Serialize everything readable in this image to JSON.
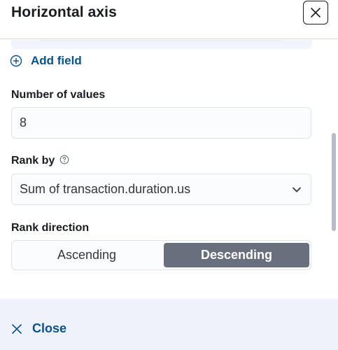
{
  "header": {
    "title": "Horizontal axis",
    "close_icon": "close-icon"
  },
  "add_field": {
    "label": "Add field",
    "icon": "plus-circle-icon"
  },
  "number_of_values": {
    "label": "Number of values",
    "value": "8"
  },
  "rank_by": {
    "label": "Rank by",
    "help_icon": "question-circle-icon",
    "selected": "Sum of transaction.duration.us"
  },
  "rank_direction": {
    "label": "Rank direction",
    "options": [
      "Ascending",
      "Descending"
    ],
    "selected": "Descending"
  },
  "footer": {
    "close_label": "Close",
    "close_icon": "cross-icon"
  },
  "colors": {
    "accent": "#07538f",
    "selected_segment": "#69707d",
    "footer_bg": "#eff2fa"
  }
}
